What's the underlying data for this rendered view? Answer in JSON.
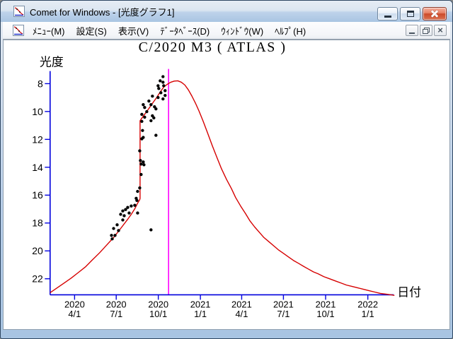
{
  "window": {
    "title": "Comet for Windows - [光度グラフ1]"
  },
  "menu_bar": {
    "items": [
      {
        "name": "menu",
        "label": "ﾒﾆｭｰ(M)"
      },
      {
        "name": "settings",
        "label": "設定(S)"
      },
      {
        "name": "view",
        "label": "表示(V)"
      },
      {
        "name": "database",
        "label": "ﾃﾞｰﾀﾍﾞｰｽ(D)"
      },
      {
        "name": "window",
        "label": "ｳｨﾝﾄﾞｳ(W)"
      },
      {
        "name": "help",
        "label": "ﾍﾙﾌﾟ(H)"
      }
    ]
  },
  "chart_data": {
    "type": "scatter",
    "title": "C/2020 M3 ( ATLAS )",
    "xlabel": "日付",
    "ylabel": "光度",
    "legend": "none",
    "grid": false,
    "y_axis": {
      "ticks": [
        8,
        10,
        12,
        14,
        16,
        18,
        20,
        22
      ],
      "inverted": true,
      "range": [
        7.1,
        23.2
      ]
    },
    "x_axis": {
      "range": [
        2020.09,
        2022.17
      ],
      "ticks": [
        {
          "year": "2020",
          "date": "4/1",
          "t": 2020.2486
        },
        {
          "year": "2020",
          "date": "7/1",
          "t": 2020.4973
        },
        {
          "year": "2020",
          "date": "10/1",
          "t": 2020.7486
        },
        {
          "year": "2021",
          "date": "1/1",
          "t": 2021.0
        },
        {
          "year": "2021",
          "date": "4/1",
          "t": 2021.2466
        },
        {
          "year": "2021",
          "date": "7/1",
          "t": 2021.4959
        },
        {
          "year": "2021",
          "date": "10/1",
          "t": 2021.7479
        },
        {
          "year": "2022",
          "date": "1/1",
          "t": 2022.0
        }
      ]
    },
    "event_line_t": 2020.81,
    "colors": {
      "curve": "#d60000",
      "axis": "#0000dd",
      "event_line": "#ff00ff",
      "points": "#000000",
      "text": "#000000"
    },
    "model_curve": [
      [
        2020.1023,
        23.0
      ],
      [
        2020.1444,
        22.65
      ],
      [
        2020.1866,
        22.3
      ],
      [
        2020.2287,
        21.95
      ],
      [
        2020.2709,
        21.55
      ],
      [
        2020.313,
        21.15
      ],
      [
        2020.3552,
        20.64
      ],
      [
        2020.3973,
        20.14
      ],
      [
        2020.4395,
        19.59
      ],
      [
        2020.4816,
        19.04
      ],
      [
        2020.5238,
        18.39
      ],
      [
        2020.5659,
        17.73
      ],
      [
        2020.587,
        17.38
      ],
      [
        2020.6081,
        16.98
      ],
      [
        2020.6249,
        16.58
      ],
      [
        2020.6376,
        16.33
      ],
      [
        2020.6397,
        16.23
      ],
      [
        2020.6397,
        10.66
      ],
      [
        2020.6544,
        10.41
      ],
      [
        2020.6755,
        10.06
      ],
      [
        2020.6966,
        9.71
      ],
      [
        2020.7176,
        9.35
      ],
      [
        2020.7387,
        9.0
      ],
      [
        2020.7598,
        8.6
      ],
      [
        2020.7808,
        8.25
      ],
      [
        2020.8019,
        8.05
      ],
      [
        2020.823,
        7.9
      ],
      [
        2020.844,
        7.82
      ],
      [
        2020.8651,
        7.8
      ],
      [
        2020.8862,
        7.9
      ],
      [
        2020.9073,
        8.1
      ],
      [
        2020.9284,
        8.45
      ],
      [
        2020.9494,
        8.9
      ],
      [
        2020.9705,
        9.4
      ],
      [
        2020.9916,
        9.96
      ],
      [
        2021.0169,
        10.71
      ],
      [
        2021.0421,
        11.51
      ],
      [
        2021.0716,
        12.47
      ],
      [
        2021.1011,
        13.37
      ],
      [
        2021.1264,
        14.12
      ],
      [
        2021.1559,
        14.87
      ],
      [
        2021.1854,
        15.53
      ],
      [
        2021.2107,
        16.18
      ],
      [
        2021.2402,
        16.78
      ],
      [
        2021.2697,
        17.33
      ],
      [
        2021.295,
        17.83
      ],
      [
        2021.3245,
        18.29
      ],
      [
        2021.354,
        18.69
      ],
      [
        2021.3793,
        19.04
      ],
      [
        2021.4088,
        19.34
      ],
      [
        2021.4383,
        19.64
      ],
      [
        2021.4678,
        19.94
      ],
      [
        2021.4973,
        20.19
      ],
      [
        2021.5268,
        20.44
      ],
      [
        2021.5563,
        20.69
      ],
      [
        2021.5858,
        20.89
      ],
      [
        2021.6153,
        21.1
      ],
      [
        2021.6448,
        21.3
      ],
      [
        2021.6743,
        21.5
      ],
      [
        2021.7038,
        21.65
      ],
      [
        2021.7375,
        21.85
      ],
      [
        2021.7712,
        22.0
      ],
      [
        2021.8049,
        22.15
      ],
      [
        2021.8386,
        22.3
      ],
      [
        2021.8724,
        22.45
      ],
      [
        2021.9061,
        22.55
      ],
      [
        2021.9398,
        22.65
      ],
      [
        2021.9735,
        22.75
      ],
      [
        2022.0072,
        22.85
      ],
      [
        2022.0409,
        22.95
      ],
      [
        2022.0746,
        23.05
      ],
      [
        2022.1083,
        23.1
      ],
      [
        2022.1378,
        23.15
      ],
      [
        2022.1589,
        23.2
      ]
    ],
    "observations": [
      [
        2020.7766,
        7.5
      ],
      [
        2020.7598,
        7.8
      ],
      [
        2020.7766,
        7.9
      ],
      [
        2020.7471,
        8.15
      ],
      [
        2020.7808,
        8.15
      ],
      [
        2020.7513,
        8.35
      ],
      [
        2020.7893,
        8.5
      ],
      [
        2020.764,
        8.65
      ],
      [
        2020.7893,
        8.85
      ],
      [
        2020.7471,
        9.0
      ],
      [
        2020.7766,
        9.1
      ],
      [
        2020.7134,
        8.9
      ],
      [
        2020.6923,
        9.25
      ],
      [
        2020.6586,
        9.51
      ],
      [
        2020.667,
        9.71
      ],
      [
        2020.705,
        9.51
      ],
      [
        2020.7261,
        9.66
      ],
      [
        2020.7345,
        9.81
      ],
      [
        2020.6797,
        10.01
      ],
      [
        2020.6502,
        10.21
      ],
      [
        2020.667,
        10.41
      ],
      [
        2020.7134,
        10.31
      ],
      [
        2020.7218,
        10.46
      ],
      [
        2020.705,
        10.66
      ],
      [
        2020.6502,
        10.71
      ],
      [
        2020.6544,
        11.36
      ],
      [
        2020.6586,
        11.86
      ],
      [
        2020.6502,
        11.96
      ],
      [
        2020.7345,
        11.71
      ],
      [
        2020.6376,
        12.82
      ],
      [
        2020.6418,
        13.52
      ],
      [
        2020.6586,
        13.62
      ],
      [
        2020.646,
        13.77
      ],
      [
        2020.6628,
        13.82
      ],
      [
        2020.646,
        14.52
      ],
      [
        2020.6376,
        15.48
      ],
      [
        2020.6249,
        15.73
      ],
      [
        2020.6165,
        16.23
      ],
      [
        2020.6207,
        16.38
      ],
      [
        2020.6081,
        16.73
      ],
      [
        2020.587,
        16.78
      ],
      [
        2020.566,
        16.88
      ],
      [
        2020.5533,
        17.03
      ],
      [
        2020.5365,
        17.13
      ],
      [
        2020.5744,
        17.28
      ],
      [
        2020.5449,
        17.48
      ],
      [
        2020.5238,
        17.38
      ],
      [
        2020.5365,
        17.78
      ],
      [
        2020.6249,
        17.28
      ],
      [
        2020.705,
        18.49
      ],
      [
        2020.5028,
        18.13
      ],
      [
        2020.5112,
        18.54
      ],
      [
        2020.4817,
        18.39
      ],
      [
        2020.4901,
        18.89
      ],
      [
        2020.4691,
        18.89
      ],
      [
        2020.4733,
        19.14
      ]
    ]
  }
}
